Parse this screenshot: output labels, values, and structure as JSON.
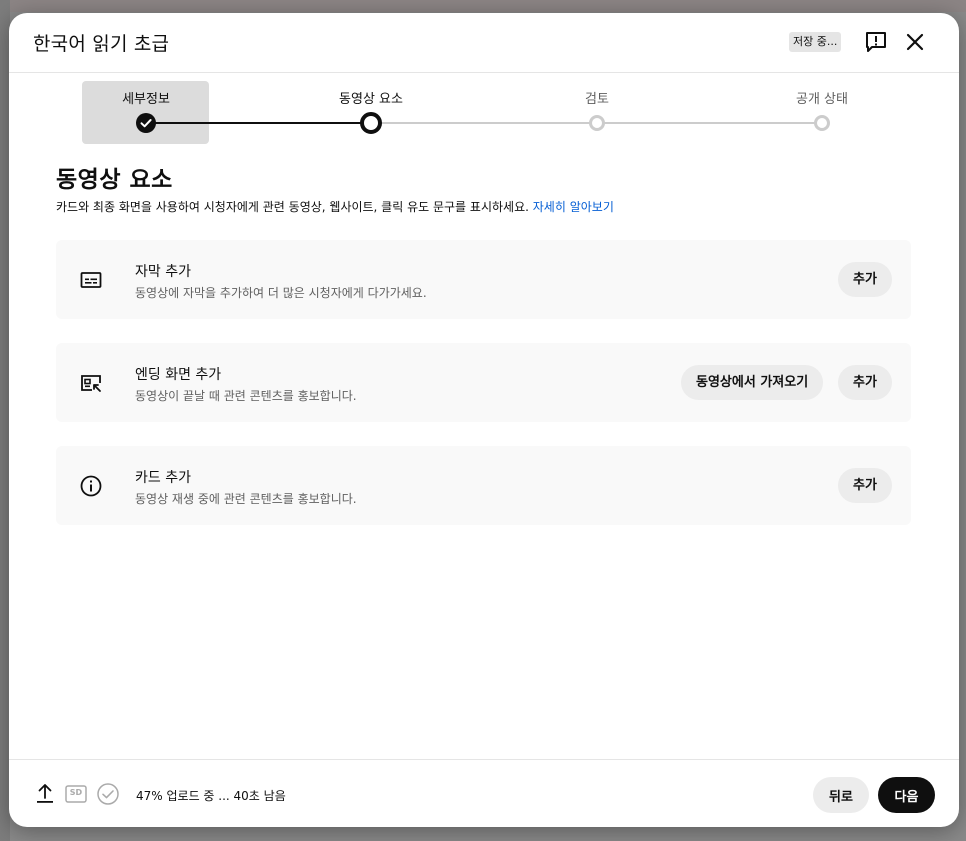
{
  "dialog": {
    "title": "한국어 읽기 초급",
    "saving_badge": "저장 중...",
    "feedback_icon": "feedback-icon",
    "close_icon": "close-icon"
  },
  "stepper": {
    "steps": [
      {
        "label": "세부정보",
        "state": "done"
      },
      {
        "label": "동영상 요소",
        "state": "current"
      },
      {
        "label": "검토",
        "state": "upcoming"
      },
      {
        "label": "공개 상태",
        "state": "upcoming"
      }
    ]
  },
  "main": {
    "title": "동영상 요소",
    "description": "카드와 최종 화면을 사용하여 시청자에게 관련 동영상, 웹사이트, 클릭 유도 문구를 표시하세요.",
    "learn_more": "자세히 알아보기",
    "cards": [
      {
        "icon": "subtitles-icon",
        "title": "자막 추가",
        "subtitle": "동영상에 자막을 추가하여 더 많은 시청자에게 다가가세요.",
        "add_label": "추가"
      },
      {
        "icon": "end-screen-icon",
        "title": "엔딩 화면 추가",
        "subtitle": "동영상이 끝날 때 관련 콘텐츠를 홍보합니다.",
        "import_label": "동영상에서 가져오기",
        "add_label": "추가"
      },
      {
        "icon": "info-icon",
        "title": "카드 추가",
        "subtitle": "동영상 재생 중에 관련 콘텐츠를 홍보합니다.",
        "add_label": "추가"
      }
    ]
  },
  "footer": {
    "sd_badge": "SD",
    "upload_status": "47% 업로드 중 ... 40초 남음",
    "back_label": "뒤로",
    "next_label": "다음"
  },
  "colors": {
    "accent_link": "#065fd4",
    "primary_button": "#0f0f0f",
    "step_inactive": "#cccccc"
  }
}
